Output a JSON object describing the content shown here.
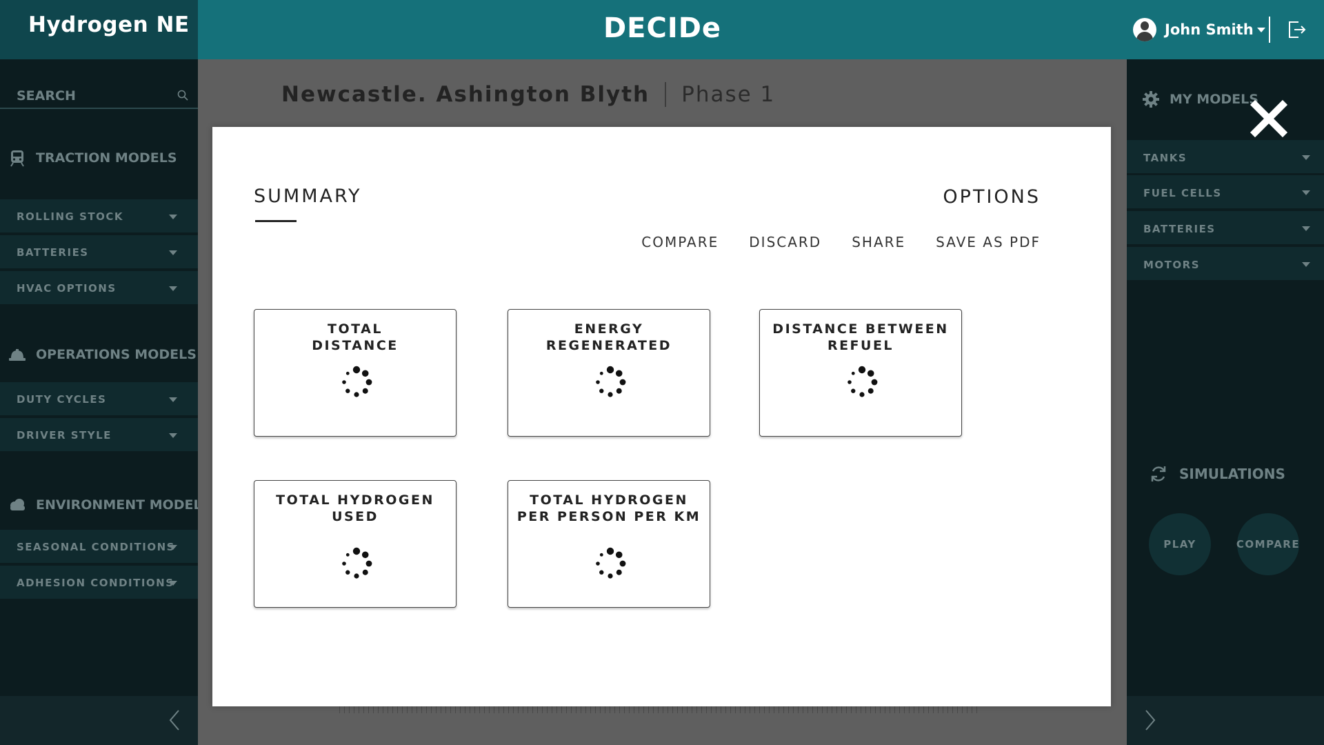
{
  "header": {
    "brand": "Hydrogen NE",
    "app_title": "DECIDe",
    "user_name": "John Smith"
  },
  "left_sidebar": {
    "search_placeholder": "SEARCH",
    "sections": [
      {
        "title": "TRACTION MODELS",
        "icon": "train-icon",
        "items": [
          "ROLLING STOCK",
          "BATTERIES",
          "HVAC OPTIONS"
        ]
      },
      {
        "title": "OPERATIONS MODELS",
        "icon": "hard-hat-icon",
        "items": [
          "DUTY CYCLES",
          "DRIVER STYLE"
        ]
      },
      {
        "title": "ENVIRONMENT MODELS",
        "icon": "cloud-icon",
        "items": [
          "SEASONAL CONDITIONS",
          "ADHESION CONDITIONS"
        ]
      }
    ]
  },
  "right_panel": {
    "my_models": "MY MODELS",
    "items": [
      "TANKS",
      "FUEL CELLS",
      "BATTERIES",
      "MOTORS"
    ],
    "simulations": "SIMULATIONS",
    "play": "PLAY",
    "compare": "COMPARE"
  },
  "project": {
    "name": "Newcastle. Ashington Blyth",
    "phase": "Phase 1"
  },
  "modal": {
    "summary": "SUMMARY",
    "options": "OPTIONS",
    "actions": [
      "COMPARE",
      "DISCARD",
      "SHARE",
      "SAVE AS PDF"
    ],
    "cards": [
      "TOTAL\nDISTANCE",
      "ENERGY\nREGENERATED",
      "DISTANCE BETWEEN\nREFUEL",
      "TOTAL HYDROGEN\nUSED",
      "TOTAL HYDROGEN\nPER PERSON PER KM"
    ],
    "loading": true
  },
  "colors": {
    "header": "#15717a",
    "brand_bg": "#0f464d",
    "sidebar_bg": "#0c1c1f",
    "sidebar_item": "#102a2e",
    "overlay": "#5f5f5f",
    "modal_bg": "#ffffff"
  }
}
